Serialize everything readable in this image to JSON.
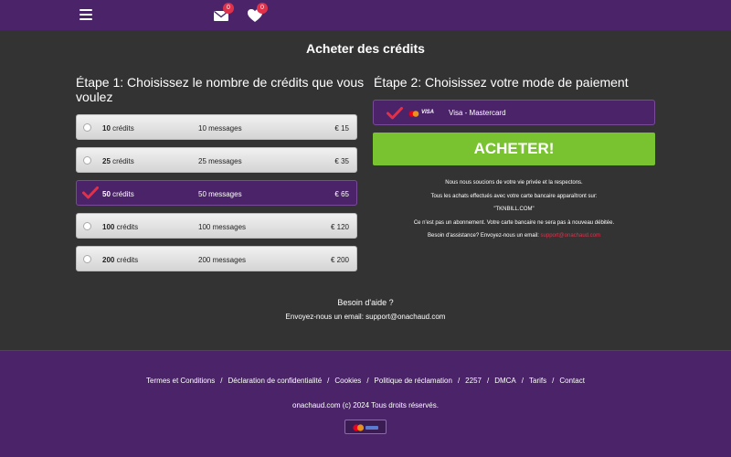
{
  "header": {
    "messages_count": "0",
    "favorites_count": "0"
  },
  "page": {
    "title": "Acheter des crédits"
  },
  "step1": {
    "title": "Étape 1: Choisissez le nombre de crédits que vous voulez",
    "credits_word": "crédits",
    "options": [
      {
        "credits": "10",
        "messages": "10 messages",
        "price": "€ 15",
        "selected": false
      },
      {
        "credits": "25",
        "messages": "25 messages",
        "price": "€ 35",
        "selected": false
      },
      {
        "credits": "50",
        "messages": "50 messages",
        "price": "€ 65",
        "selected": true
      },
      {
        "credits": "100",
        "messages": "100 messages",
        "price": "€ 120",
        "selected": false
      },
      {
        "credits": "200",
        "messages": "200 messages",
        "price": "€ 200",
        "selected": false
      }
    ]
  },
  "step2": {
    "title": "Étape 2: Choisissez votre mode de paiement",
    "method_label": "Visa - Mastercard",
    "visa_text": "VISA",
    "buy_label": "ACHETER!"
  },
  "info": {
    "line1": "Nous nous soucions de votre vie privée et la respectons.",
    "line2": "Tous les achats effectués avec votre carte bancaire apparaîtront sur:",
    "line3": "\"TKNBILL.COM\"",
    "line4": "Ce n'est pas un abonnement. Votre carte bancaire ne sera pas à nouveau débitée.",
    "line5_prefix": "Besoin d'assistance? Envoyez-nous un email:",
    "line5_email": "support@onachaud.com"
  },
  "help": {
    "title": "Besoin d'aide ?",
    "line": "Envoyez-nous un email: support@onachaud.com"
  },
  "footer": {
    "links": [
      "Termes et Conditions",
      "Déclaration de confidentialité",
      "Cookies",
      "Politique de réclamation",
      "2257",
      "DMCA",
      "Tarifs",
      "Contact"
    ],
    "copyright": "onachaud.com (c) 2024 Tous droits réservés."
  },
  "colors": {
    "brand_purple": "#4a2368",
    "background": "#333333",
    "buy_green": "#79c331",
    "accent_red": "#e0314b"
  },
  "icons": {
    "menu": "hamburger-menu-icon",
    "messages": "envelope-icon",
    "favorites": "heart-icon",
    "selected": "checkmark-icon",
    "payment": "mastercard-icon"
  }
}
